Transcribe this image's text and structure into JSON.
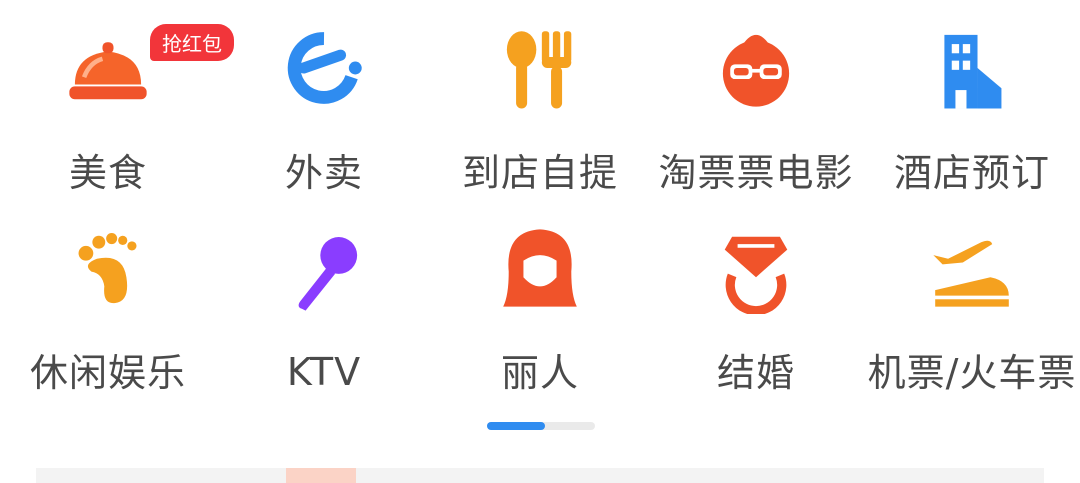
{
  "badge": "抢红包",
  "row1": [
    {
      "label": "美食",
      "icon": "food-cloche-icon"
    },
    {
      "label": "外卖",
      "icon": "delivery-e-icon"
    },
    {
      "label": "到店自提",
      "icon": "fork-spoon-icon"
    },
    {
      "label": "淘票票电影",
      "icon": "movie-mascot-icon"
    },
    {
      "label": "酒店预订",
      "icon": "hotel-building-icon"
    }
  ],
  "row2": [
    {
      "label": "休闲娱乐",
      "icon": "footprint-icon"
    },
    {
      "label": "KTV",
      "icon": "microphone-icon"
    },
    {
      "label": "丽人",
      "icon": "beauty-face-icon"
    },
    {
      "label": "结婚",
      "icon": "wedding-ring-icon"
    },
    {
      "label": "机票/火车票",
      "icon": "plane-train-icon"
    }
  ],
  "colors": {
    "orange": "#f5a11f",
    "red": "#f0532a",
    "blue": "#2f8cf0",
    "purple": "#8a3dff",
    "badge": "#f2353a"
  },
  "pager": {
    "pages": 2,
    "current": 1
  }
}
